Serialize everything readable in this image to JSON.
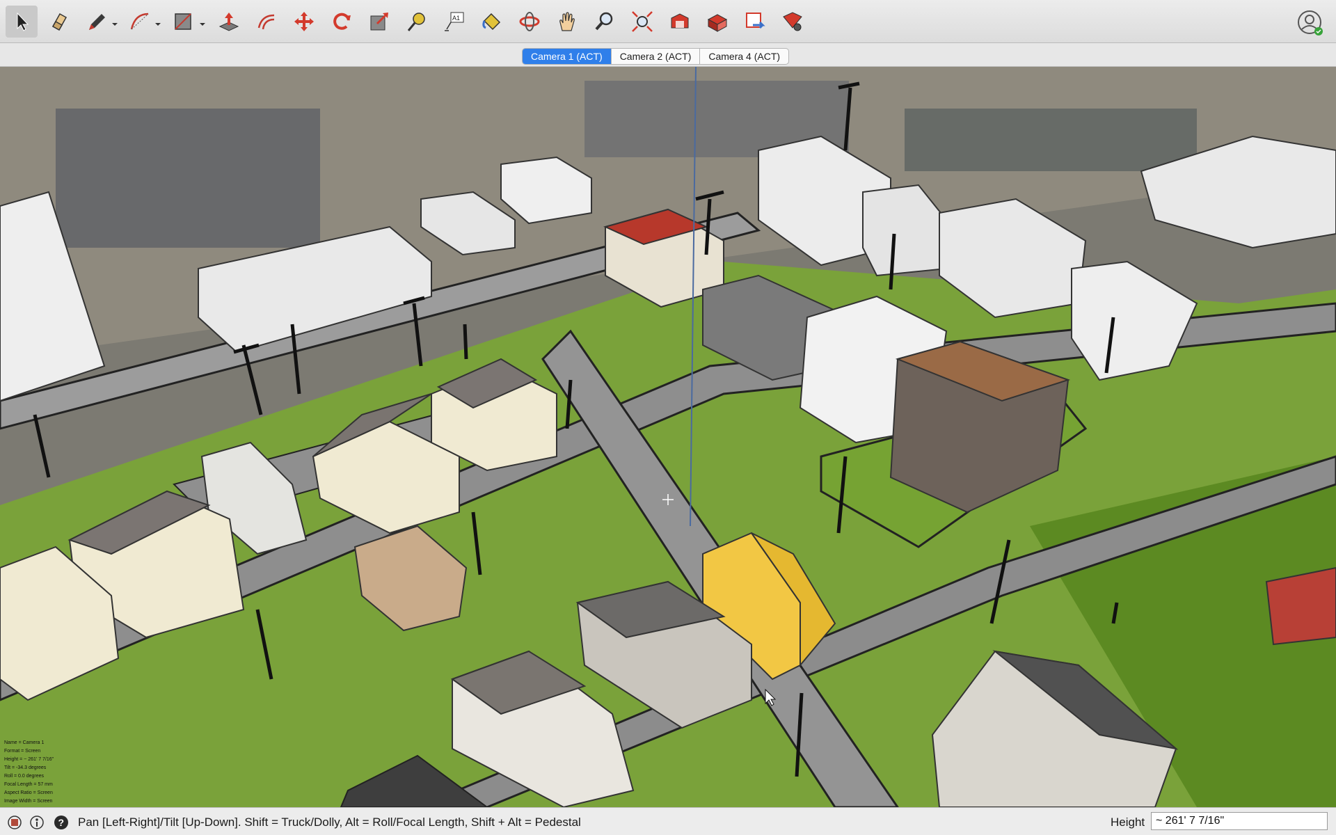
{
  "toolbar": {
    "tools": [
      {
        "name": "select-tool",
        "icon": "arrow-cursor-icon",
        "active": true
      },
      {
        "name": "eraser-tool",
        "icon": "eraser-icon"
      },
      {
        "name": "pencil-tool",
        "icon": "pencil-icon",
        "dropdown": true
      },
      {
        "name": "arc-tool",
        "icon": "arc-icon",
        "dropdown": true
      },
      {
        "name": "rectangle-tool",
        "icon": "rectangle-icon",
        "dropdown": true
      },
      {
        "name": "push-pull-tool",
        "icon": "push-pull-icon"
      },
      {
        "name": "offset-tool",
        "icon": "offset-icon"
      },
      {
        "name": "move-tool",
        "icon": "move-arrows-icon"
      },
      {
        "name": "rotate-tool",
        "icon": "rotate-icon"
      },
      {
        "name": "scale-tool",
        "icon": "scale-icon"
      },
      {
        "name": "tape-measure-tool",
        "icon": "tape-measure-icon"
      },
      {
        "name": "text-tool",
        "icon": "text-label-icon",
        "label": "A1"
      },
      {
        "name": "paint-bucket-tool",
        "icon": "paint-bucket-icon"
      },
      {
        "name": "orbit-tool",
        "icon": "orbit-icon"
      },
      {
        "name": "pan-tool",
        "icon": "hand-icon"
      },
      {
        "name": "zoom-tool",
        "icon": "magnifier-icon"
      },
      {
        "name": "zoom-extents-tool",
        "icon": "zoom-extents-icon"
      },
      {
        "name": "warehouse-tool",
        "icon": "warehouse-icon"
      },
      {
        "name": "extension-warehouse-tool",
        "icon": "extension-warehouse-icon"
      },
      {
        "name": "send-to-layout-tool",
        "icon": "layout-icon"
      },
      {
        "name": "extension-manager-tool",
        "icon": "extension-manager-icon"
      }
    ],
    "profile_icon": "user-profile-icon"
  },
  "scenes": {
    "tabs": [
      {
        "label": "Camera 1 (ACT)",
        "active": true
      },
      {
        "label": "Camera 2 (ACT)",
        "active": false
      },
      {
        "label": "Camera 4 (ACT)",
        "active": false
      }
    ]
  },
  "viewport": {
    "camera_info": [
      "Name = Camera 1",
      "Format = Screen",
      "Height = ~ 261' 7 7/16\"",
      "Tilt = -34.3 degrees",
      "Roll = 0.0 degrees",
      "Focal Length = 57 mm",
      "Aspect Ratio = Screen",
      "Image Width = Screen"
    ]
  },
  "statusbar": {
    "icons": [
      "geolocation-icon",
      "credits-icon",
      "help-icon"
    ],
    "message": "Pan [Left-Right]/Tilt [Up-Down]. Shift = Truck/Dolly, Alt = Roll/Focal Length, Shift + Alt = Pedestal",
    "measurement_label": "Height",
    "measurement_value": "~ 261' 7 7/16\""
  }
}
